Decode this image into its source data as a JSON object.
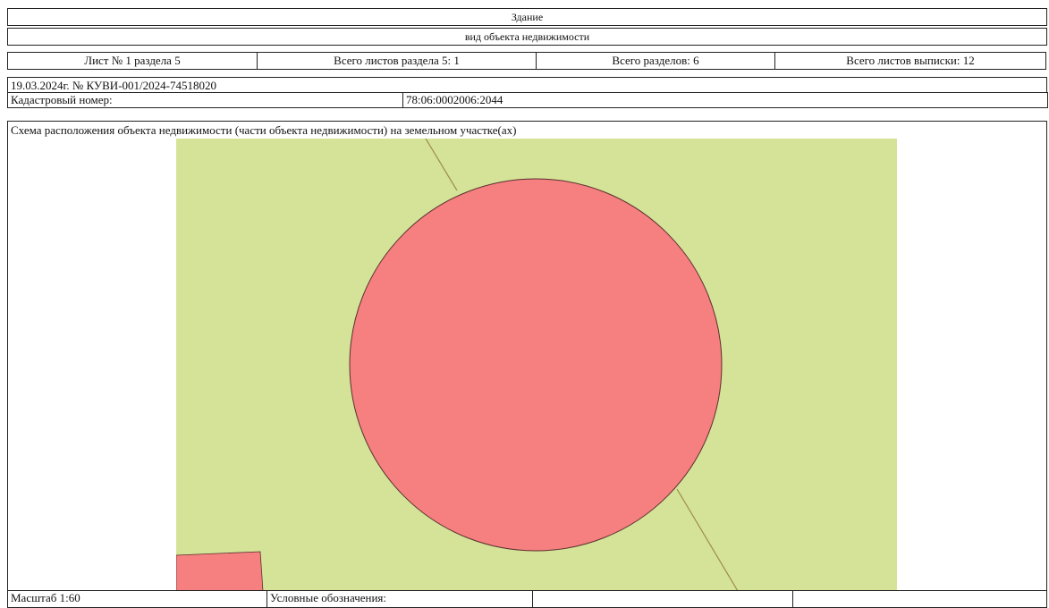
{
  "header": {
    "title": "Здание",
    "subtitle": "вид объекта недвижимости"
  },
  "sheet_info": {
    "sheet": "Лист № 1 раздела 5",
    "section_sheets": "Всего листов раздела 5: 1",
    "sections": "Всего разделов: 6",
    "statement_sheets": "Всего листов выписки: 12"
  },
  "record": {
    "date_number": "19.03.2024г. № КУВИ-001/2024-74518020",
    "cadastral_label": "Кадастровый номер:",
    "cadastral_value": "78:06:0002006:2044"
  },
  "scheme": {
    "caption": "Схема расположения объекта недвижимости (части объекта недвижимости) на земельном участке(ах)",
    "colors": {
      "land_plot": "#d4e397",
      "building": "#f67f7f",
      "boundary_line": "#9e8a4a",
      "outline": "#5a3030"
    }
  },
  "footer": {
    "scale": "Масштаб 1:60",
    "legend_label": "Условные обозначения:",
    "cell3": "",
    "cell4": ""
  }
}
